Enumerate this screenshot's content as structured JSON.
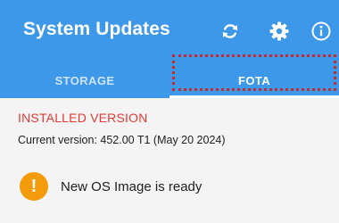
{
  "appbar": {
    "title": "System Updates",
    "background": "#3d98ea",
    "actions": [
      {
        "icon": "sync-icon"
      },
      {
        "icon": "gear-icon"
      },
      {
        "icon": "info-icon"
      }
    ]
  },
  "tabs": [
    {
      "label": "STORAGE",
      "selected": false
    },
    {
      "label": "FOTA",
      "selected": true
    }
  ],
  "annotation_color": "#c62b2b",
  "installed": {
    "heading": "INSTALLED VERSION",
    "heading_color": "#e53935",
    "current_version": "Current version: 452.00 T1 (May 20 2024)"
  },
  "notice": {
    "icon": "warning-icon",
    "icon_glyph": "!",
    "icon_color": "#f39b0b",
    "text": "New OS Image is ready"
  }
}
